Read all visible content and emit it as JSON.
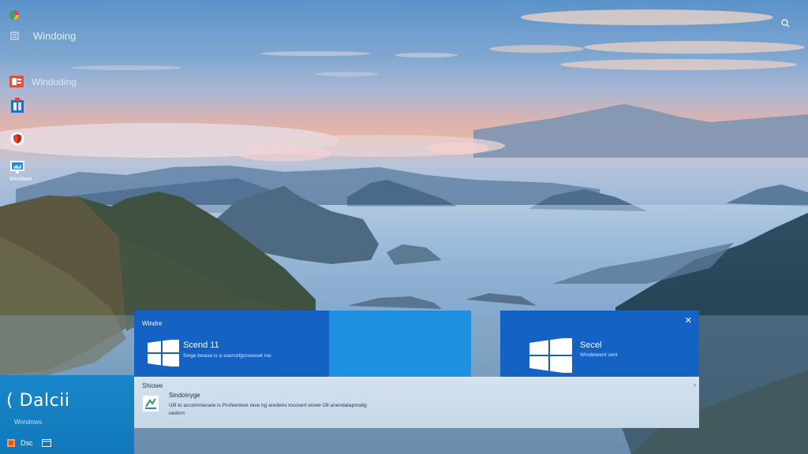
{
  "desktop": {
    "top_label": "Windoing",
    "icon_labels": [
      "Windoding"
    ],
    "bottom_icon_label": "Windaws"
  },
  "left_pane": {
    "title": "( Dalcii",
    "subtitle": "Wondows"
  },
  "taskbar": {
    "item_label": "Dsc"
  },
  "tiles": [
    {
      "caption": "Windre",
      "title": "Scend 11",
      "subtitle": "Singe bwase is a sourcefgcreeeset me"
    },
    {
      "title": "Secel",
      "subtitle": "Windelwent sent"
    }
  ],
  "list_panel": {
    "header": "Shiowe",
    "title": "Sindoinyge",
    "desc": "Uifi  to  accommecare is Profeenkee reve ng  aredens  tocosert  wowe  Oll  anendatapmalig",
    "desc2": "uedom"
  },
  "colors": {
    "tile_blue": "#1463c4",
    "tile_light_blue": "#1f8fdf",
    "left_pane": "#1681c4",
    "list_panel": "#cddbe9"
  },
  "icons": [
    "colorful-app-icon",
    "menu-icon",
    "search-icon",
    "office-icon",
    "store-icon",
    "shield-icon",
    "monitor-icon",
    "windows-logo-icon",
    "close-icon",
    "chevron-right-icon"
  ]
}
